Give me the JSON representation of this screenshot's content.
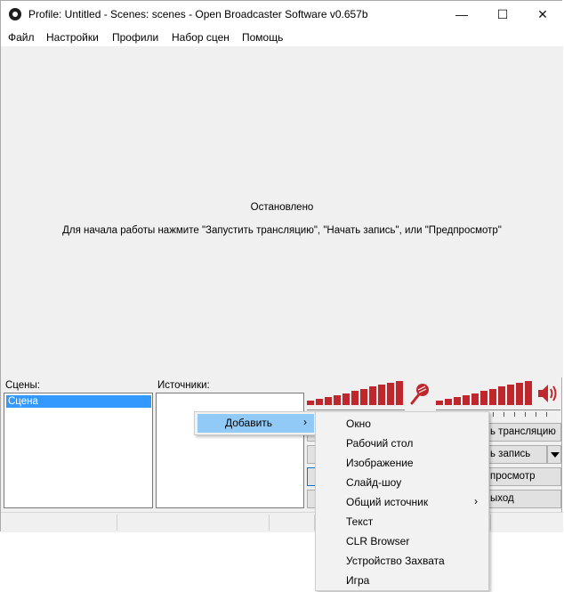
{
  "window": {
    "title": "Profile: Untitled - Scenes: scenes - Open Broadcaster Software v0.657b",
    "minimize": "—",
    "maximize": "☐",
    "close": "✕"
  },
  "menubar": {
    "items": [
      "Файл",
      "Настройки",
      "Профили",
      "Набор сцен",
      "Помощь"
    ]
  },
  "preview": {
    "status": "Остановлено",
    "hint": "Для начала работы нажмите \"Запустить трансляцию\", \"Начать запись\", или \"Предпросмотр\""
  },
  "scenes": {
    "label": "Сцены:",
    "items": [
      "Сцена"
    ]
  },
  "sources": {
    "label": "Источники:"
  },
  "audio": {
    "mic_icon": "microphone-icon",
    "speaker_icon": "speaker-icon",
    "accent_color": "#c0272d"
  },
  "buttons": {
    "stream": "ь трансляцию",
    "record": "ь запись",
    "preview": "просмотр",
    "exit": "ыход"
  },
  "context_menu": {
    "add": "Добавить",
    "add_arrow": "›"
  },
  "submenu": {
    "items": [
      "Окно",
      "Рабочий стол",
      "Изображение",
      "Слайд-шоу",
      "Общий источник",
      "Текст",
      "CLR Browser",
      "Устройство Захвата",
      "Игра"
    ],
    "shared_arrow": "›"
  }
}
